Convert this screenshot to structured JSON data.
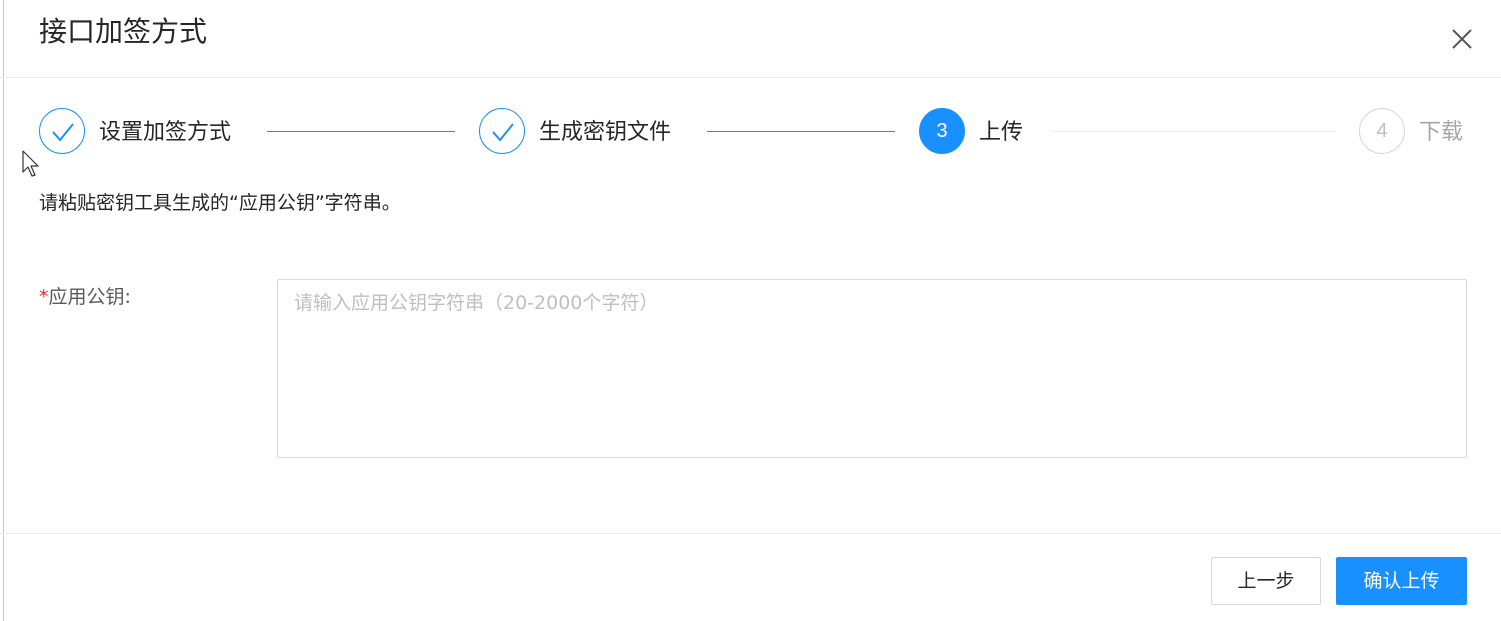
{
  "dialog": {
    "title": "接口加签方式",
    "close_icon": "close-icon"
  },
  "steps": [
    {
      "number": "1",
      "label": "设置加签方式",
      "status": "finished",
      "icon": "check-icon"
    },
    {
      "number": "2",
      "label": "生成密钥文件",
      "status": "finished",
      "icon": "check-icon"
    },
    {
      "number": "3",
      "label": "上传",
      "status": "active"
    },
    {
      "number": "4",
      "label": "下载",
      "status": "waiting"
    }
  ],
  "hint_text": "请粘贴密钥工具生成的“应用公钥”字符串。",
  "form": {
    "required_mark": "*",
    "public_key_label": "应用公钥:",
    "public_key_value": "",
    "public_key_placeholder": "请输入应用公钥字符串（20-2000个字符）"
  },
  "footer": {
    "prev_button": "上一步",
    "confirm_button": "确认上传"
  },
  "colors": {
    "primary": "#1890ff",
    "required": "#f5222d",
    "wait": "#bfbfbf"
  }
}
